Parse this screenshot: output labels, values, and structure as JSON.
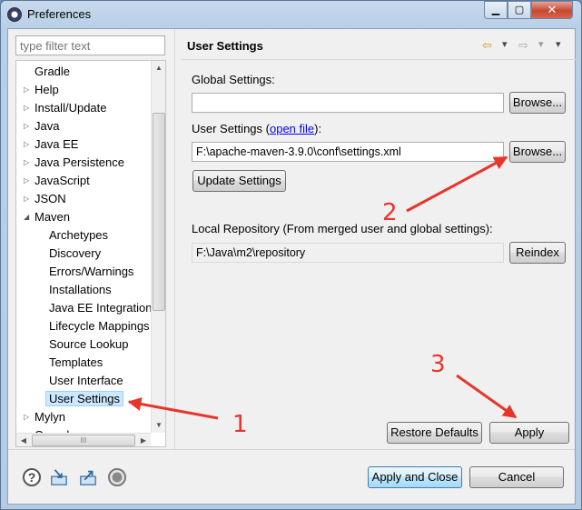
{
  "window": {
    "title": "Preferences",
    "minimize": "▁",
    "maximize": "▢",
    "close": "✕"
  },
  "filter": {
    "placeholder": "type filter text"
  },
  "tree": {
    "items": [
      {
        "label": "Gradle",
        "level": 1,
        "arrow": ""
      },
      {
        "label": "Help",
        "level": 1,
        "arrow": "▷"
      },
      {
        "label": "Install/Update",
        "level": 1,
        "arrow": "▷"
      },
      {
        "label": "Java",
        "level": 1,
        "arrow": "▷"
      },
      {
        "label": "Java EE",
        "level": 1,
        "arrow": "▷"
      },
      {
        "label": "Java Persistence",
        "level": 1,
        "arrow": "▷"
      },
      {
        "label": "JavaScript",
        "level": 1,
        "arrow": "▷"
      },
      {
        "label": "JSON",
        "level": 1,
        "arrow": "▷"
      },
      {
        "label": "Maven",
        "level": 1,
        "arrow": "◢"
      },
      {
        "label": "Archetypes",
        "level": 2,
        "arrow": ""
      },
      {
        "label": "Discovery",
        "level": 2,
        "arrow": ""
      },
      {
        "label": "Errors/Warnings",
        "level": 2,
        "arrow": ""
      },
      {
        "label": "Installations",
        "level": 2,
        "arrow": ""
      },
      {
        "label": "Java EE Integration",
        "level": 2,
        "arrow": ""
      },
      {
        "label": "Lifecycle Mappings",
        "level": 2,
        "arrow": ""
      },
      {
        "label": "Source Lookup",
        "level": 2,
        "arrow": ""
      },
      {
        "label": "Templates",
        "level": 2,
        "arrow": ""
      },
      {
        "label": "User Interface",
        "level": 2,
        "arrow": ""
      },
      {
        "label": "User Settings",
        "level": 2,
        "arrow": "",
        "selected": true
      },
      {
        "label": "Mylyn",
        "level": 1,
        "arrow": "▷"
      },
      {
        "label": "Oomph",
        "level": 1,
        "arrow": "▷"
      }
    ],
    "hscroll_grip": "III"
  },
  "page": {
    "title": "User Settings",
    "nav": {
      "back": "⇦",
      "back_menu": "▾",
      "forward": "⇨",
      "forward_menu": "▾",
      "view_menu": "▾"
    },
    "global_settings_label": "Global Settings:",
    "global_settings_value": "",
    "user_settings_label": "User Settings (",
    "user_settings_link": "open file",
    "user_settings_suffix": "):",
    "user_settings_value": "F:\\apache-maven-3.9.0\\conf\\settings.xml",
    "browse_label": "Browse...",
    "update_settings_label": "Update Settings",
    "local_repo_label": "Local Repository (From merged user and global settings):",
    "local_repo_value": "F:\\Java\\m2\\repository",
    "reindex_label": "Reindex",
    "restore_defaults_label": "Restore Defaults",
    "apply_label": "Apply"
  },
  "footer": {
    "help_icon": "?",
    "apply_close_label": "Apply and Close",
    "cancel_label": "Cancel"
  },
  "annotations": {
    "one": "1",
    "two": "2",
    "three": "3",
    "color": "#e8352a"
  }
}
